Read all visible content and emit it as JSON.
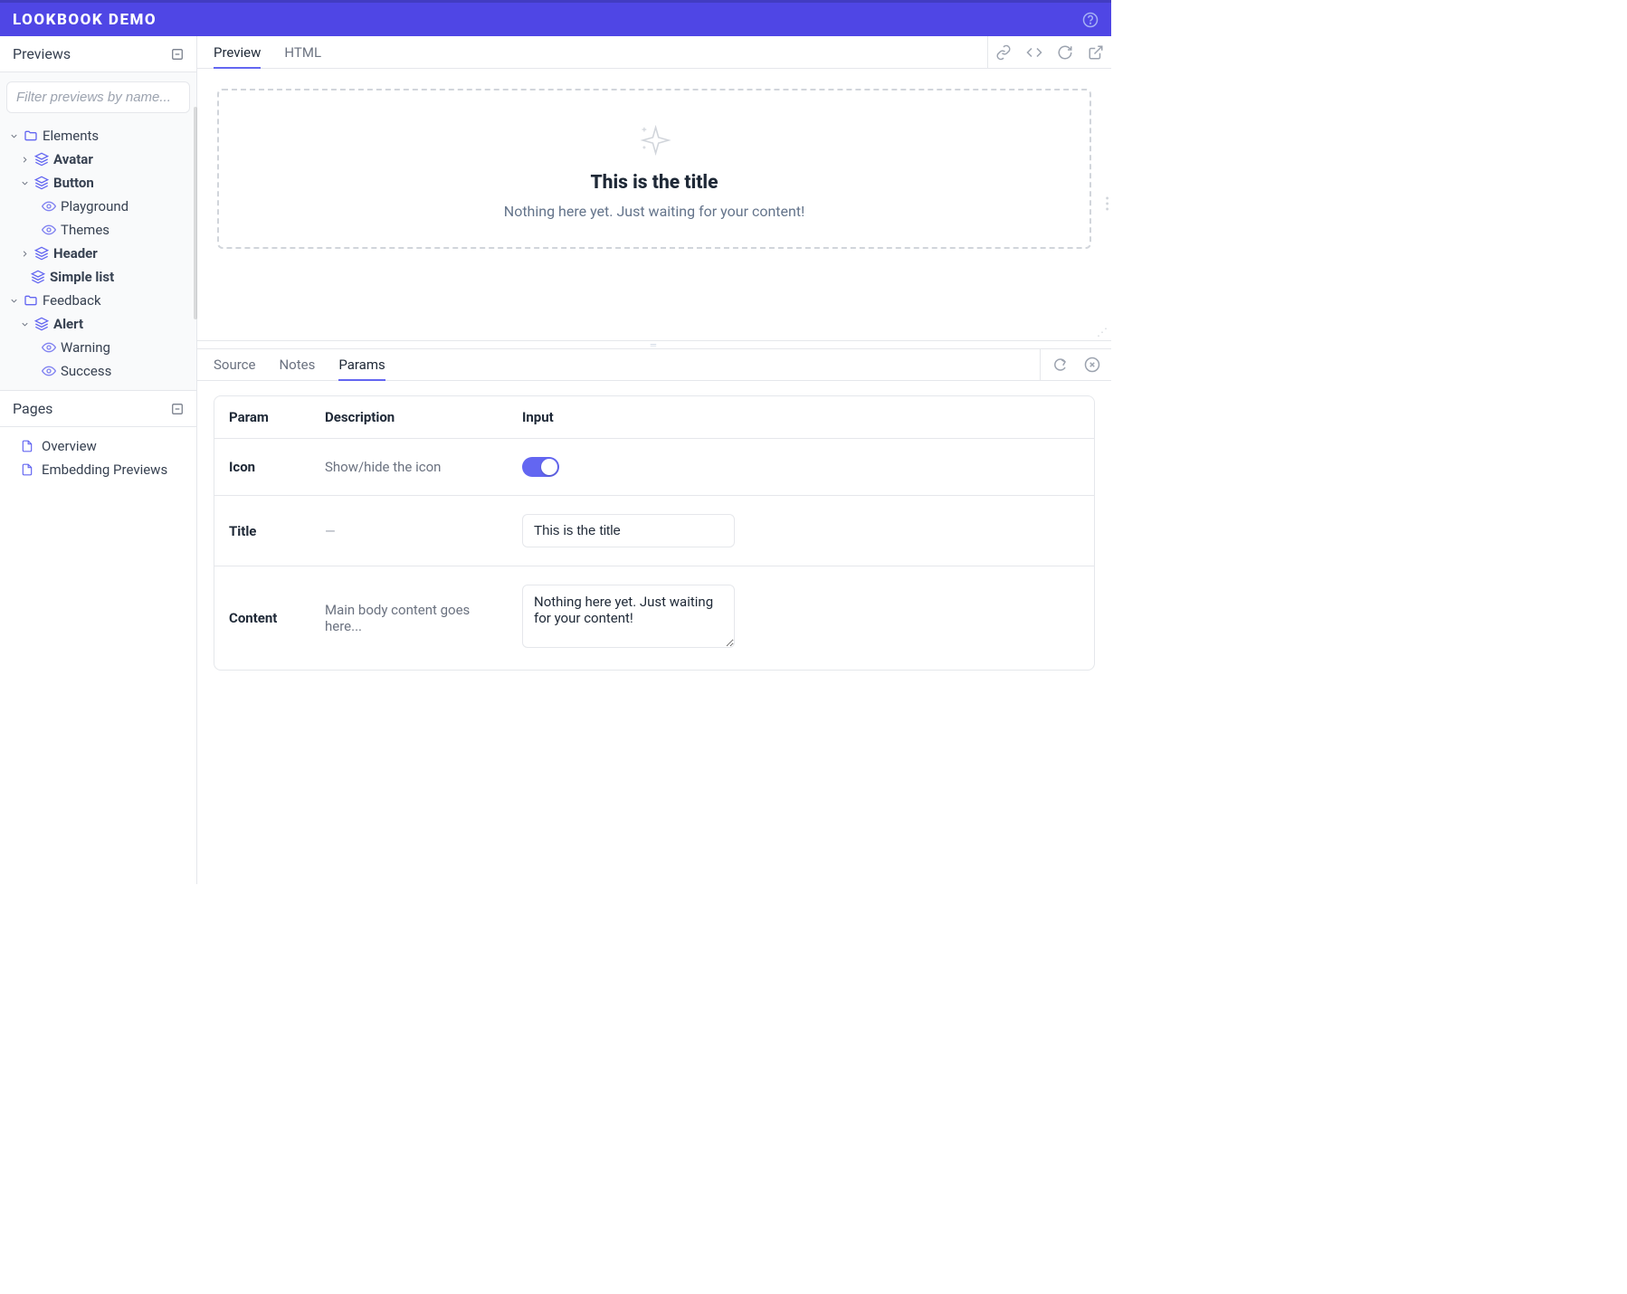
{
  "header": {
    "title": "LOOKBOOK DEMO"
  },
  "sidebar": {
    "previews_label": "Previews",
    "pages_label": "Pages",
    "filter_placeholder": "Filter previews by name...",
    "groups": [
      {
        "label": "Elements",
        "items": [
          {
            "label": "Avatar",
            "expanded": false,
            "children": []
          },
          {
            "label": "Button",
            "expanded": true,
            "children": [
              {
                "label": "Playground"
              },
              {
                "label": "Themes"
              }
            ]
          },
          {
            "label": "Header",
            "expanded": false,
            "children": []
          },
          {
            "label": "Simple list",
            "leaf": true
          }
        ]
      },
      {
        "label": "Feedback",
        "items": [
          {
            "label": "Alert",
            "expanded": true,
            "children": [
              {
                "label": "Warning"
              },
              {
                "label": "Success"
              }
            ]
          }
        ]
      }
    ],
    "pages": [
      {
        "label": "Overview"
      },
      {
        "label": "Embedding Previews"
      }
    ]
  },
  "preview": {
    "tabs": {
      "preview": "Preview",
      "html": "HTML"
    },
    "card": {
      "title": "This is the title",
      "subtitle": "Nothing here yet. Just waiting for your content!"
    }
  },
  "inspector": {
    "tabs": {
      "source": "Source",
      "notes": "Notes",
      "params": "Params"
    },
    "headers": {
      "param": "Param",
      "description": "Description",
      "input": "Input"
    },
    "rows": [
      {
        "name": "Icon",
        "desc": "Show/hide the icon",
        "type": "toggle",
        "value": true
      },
      {
        "name": "Title",
        "desc": "—",
        "type": "text",
        "value": "This is the title"
      },
      {
        "name": "Content",
        "desc": "Main body content goes here...",
        "type": "textarea",
        "value": "Nothing here yet. Just waiting for your content!"
      }
    ]
  }
}
